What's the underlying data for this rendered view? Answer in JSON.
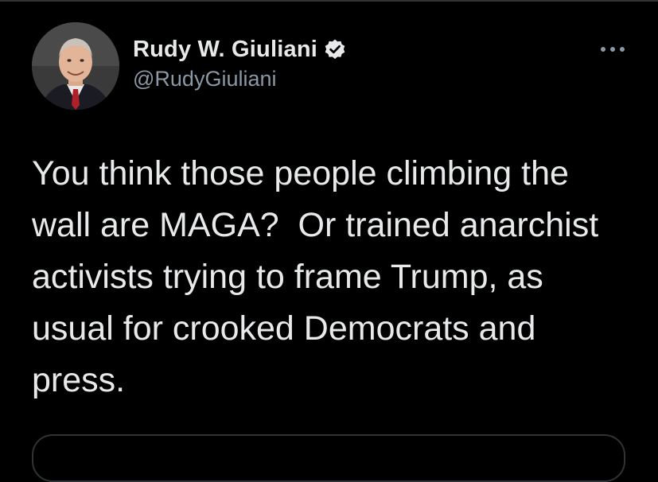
{
  "tweet": {
    "author": {
      "display_name": "Rudy W. Giuliani",
      "handle": "@RudyGiuliani",
      "verified": true,
      "avatar_icon": "profile-photo"
    },
    "text": "You think those people climbing the\nwall are MAGA?  Or trained anarchist\nactivists trying to frame Trump, as\nusual for crooked Democrats and\npress.",
    "more_icon": "ellipsis-icon"
  },
  "colors": {
    "background": "#000000",
    "text_primary": "#e7e9ea",
    "text_secondary": "#8b98a5",
    "border": "#2f3336"
  }
}
